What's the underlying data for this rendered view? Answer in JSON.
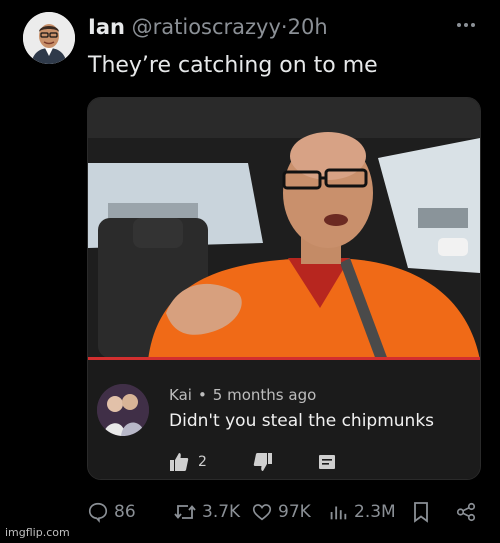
{
  "post": {
    "author_name": "Ian",
    "handle": "@ratioscrazyy",
    "separator": "·",
    "time": "20h",
    "text": "They’re catching on to me"
  },
  "media": {
    "comment": {
      "author": "Kai",
      "separator": "•",
      "time": "5 months ago",
      "text": "Didn't you steal the chipmunks",
      "likes": "2"
    }
  },
  "actions": {
    "replies": "86",
    "reposts": "3.7K",
    "likes": "97K",
    "views": "2.3M"
  },
  "watermark": "imgflip.com",
  "colors": {
    "background": "#000000",
    "muted": "#8b9096",
    "progress": "#d32f2f"
  },
  "icons": [
    "more-icon",
    "reply-icon",
    "repost-icon",
    "like-icon",
    "views-icon",
    "bookmark-icon",
    "share-icon",
    "thumbs-up-icon",
    "thumbs-down-icon",
    "comment-reply-icon"
  ]
}
